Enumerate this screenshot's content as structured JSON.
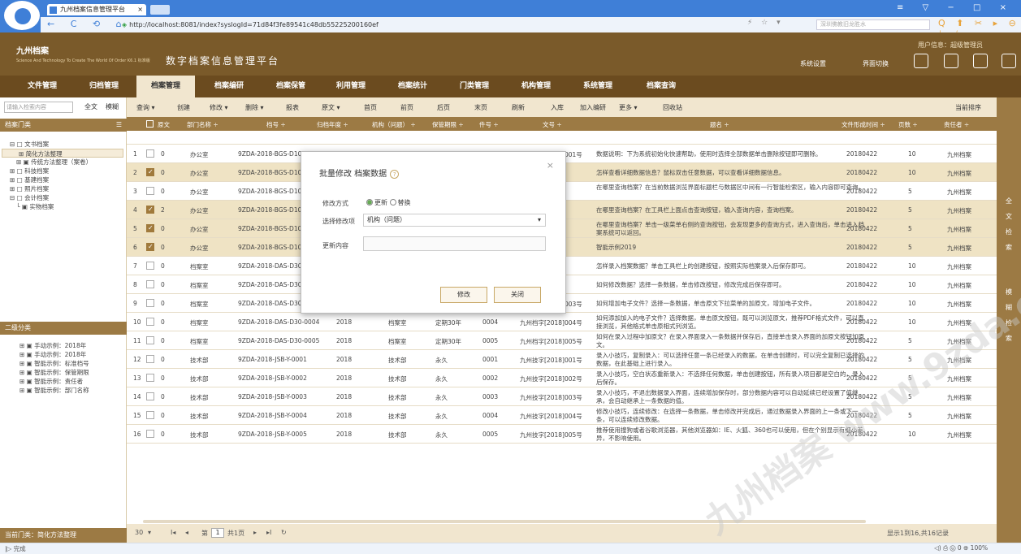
{
  "browser": {
    "tab_title": "九州档案信息管理平台",
    "tab_close": "×",
    "url": "http://localhost:8081/index?syslogId=71d84f3fe89541c48db55225200160ef",
    "search_placeholder": "深圳佛教旧龙胜水",
    "nav_icons": "← C ⟲ ⌂",
    "right_icons": "⚡ ☆ ▾",
    "right_icons2": "Q ⬆ ✂ ▸ ⊖ ⤓ ☆",
    "window_controls": "≡ ▽ − □ ×"
  },
  "header": {
    "logo_main": "九州档案",
    "logo_sub": "Science And Technology To Create The World Of Order  K6.1 标准版",
    "app_title": "数字档案信息管理平台",
    "user_info": "用户信息：超级管理员",
    "system_settings": "系统设置",
    "switch_ui": "界面切换"
  },
  "nav": [
    "文件管理",
    "归档管理",
    "档案管理",
    "档案编研",
    "档案保管",
    "利用管理",
    "档案统计",
    "门类管理",
    "机构管理",
    "系统管理",
    "档案查询"
  ],
  "sidebar": {
    "search_placeholder": "请输入检索内容",
    "fulltext": "全文",
    "fuzzy": "模糊",
    "section1": "档案门类",
    "menu_icon": "☰",
    "tree1": [
      "⊟ □ 文书档案",
      "⊞ 简化方法整理",
      "⊞ ▣ 传统方法整理（案卷）",
      "⊞ □ 科技档案",
      "⊞ □ 基建档案",
      "⊞ □ 照片档案",
      "⊟ □ 会计档案",
      "└ ▣ 实物档案"
    ],
    "section2": "二级分类",
    "tree2": [
      "⊞ ▣ 手动示例：2018年",
      "⊞ ▣ 手动示例：2018年",
      "⊞ ▣ 智能示例：标准档号",
      "⊞ ▣ 智能示例：保管期限",
      "⊞ ▣ 智能示例：责任者",
      "⊞ ▣ 智能示例：部门名称"
    ],
    "current": "当前门类：简化方法整理"
  },
  "toolbar": [
    "查询 ▾",
    "创建",
    "修改 ▾",
    "删除 ▾",
    "报表",
    "原文 ▾",
    "首页",
    "前页",
    "后页",
    "末页",
    "刷新",
    "入库",
    "加入编研",
    "更多 ▾",
    "回收站"
  ],
  "toolbar_right": "当前排序",
  "columns": [
    "原文",
    "部门名称 ÷",
    "档号 ÷",
    "归档年度 ÷",
    "机构（问题） ÷",
    "保管期限 ÷",
    "件号 ÷",
    "文号 ÷",
    "题名 ÷",
    "文件形成时间 ÷",
    "页数 ÷",
    "责任者 ÷"
  ],
  "rows": [
    {
      "n": "1",
      "chk": false,
      "yw": "0",
      "dept": "办公室",
      "dh": "9ZDA-2018-BGS-D10-0001",
      "year": "2018",
      "org": "办公室",
      "term": "定期10年",
      "jh": "0001",
      "wh": "九州查字[2018]001号",
      "title": "数据说明：下为系统初始化快速帮助，使用时选择全部数据单击删除按钮即可删除。",
      "date": "20180422",
      "pages": "10",
      "resp": "九州档案"
    },
    {
      "n": "2",
      "chk": true,
      "yw": "0",
      "dept": "办公室",
      "dh": "9ZDA-2018-BGS-D10",
      "year": "",
      "org": "",
      "term": "",
      "jh": "",
      "wh": "002号",
      "title": "怎样查看详细数据信息？鼠标双击任意数据，可以查看详细数据信息。",
      "date": "20180422",
      "pages": "10",
      "resp": "九州档案"
    },
    {
      "n": "3",
      "chk": false,
      "yw": "0",
      "dept": "办公室",
      "dh": "9ZDA-2018-BGS-D10",
      "year": "",
      "org": "",
      "term": "",
      "jh": "",
      "wh": "003号",
      "title": "在哪里查询档案？在当前数据浏览界面标题栏与数据区中间有一行智能检索区，输入内容即可查询。",
      "date": "20180422",
      "pages": "5",
      "resp": "九州档案"
    },
    {
      "n": "4",
      "chk": true,
      "yw": "2",
      "dept": "办公室",
      "dh": "9ZDA-2018-BGS-D10",
      "year": "",
      "org": "",
      "term": "",
      "jh": "",
      "wh": "004号",
      "title": "在哪里查询档案？在工具栏上面点击查询按钮，输入查询内容，查询档案。",
      "date": "20180422",
      "pages": "5",
      "resp": "九州档案"
    },
    {
      "n": "5",
      "chk": true,
      "yw": "0",
      "dept": "办公室",
      "dh": "9ZDA-2018-BGS-D10",
      "year": "",
      "org": "",
      "term": "",
      "jh": "",
      "wh": "005号",
      "title": "在哪里查询档案？单击一级菜单右侧的查询按钮，会发现更多的查询方式，进入查询后，单击进入档案系统可以返回。",
      "date": "20180422",
      "pages": "5",
      "resp": "九州档案"
    },
    {
      "n": "6",
      "chk": true,
      "yw": "0",
      "dept": "办公室",
      "dh": "9ZDA-2018-BGS-D10",
      "year": "",
      "org": "",
      "term": "",
      "jh": "",
      "wh": "005号",
      "title": "智能示例2019",
      "date": "20180422",
      "pages": "5",
      "resp": "九州档案"
    },
    {
      "n": "7",
      "chk": false,
      "yw": "0",
      "dept": "档案室",
      "dh": "9ZDA-2018-DAS-D30",
      "year": "",
      "org": "",
      "term": "",
      "jh": "",
      "wh": "001号",
      "title": "怎样录入档案数据？单击工具栏上的创建按钮，按照实际档案录入后保存即可。",
      "date": "20180422",
      "pages": "10",
      "resp": "九州档案"
    },
    {
      "n": "8",
      "chk": false,
      "yw": "0",
      "dept": "档案室",
      "dh": "9ZDA-2018-DAS-D30",
      "year": "",
      "org": "",
      "term": "",
      "jh": "",
      "wh": "002号",
      "title": "如何修改数据？选择一条数据，单击修改按钮，修改完成后保存即可。",
      "date": "20180422",
      "pages": "10",
      "resp": "九州档案"
    },
    {
      "n": "9",
      "chk": false,
      "yw": "0",
      "dept": "档案室",
      "dh": "9ZDA-2018-DAS-D30-0003",
      "year": "2018",
      "org": "档案室",
      "term": "定期30年",
      "jh": "0003",
      "wh": "九州档字[2018]003号",
      "title": "如何增加电子文件？选择一条数据，单击原文下拉菜单的加原文，增加电子文件。",
      "date": "20180422",
      "pages": "10",
      "resp": "九州档案"
    },
    {
      "n": "10",
      "chk": false,
      "yw": "0",
      "dept": "档案室",
      "dh": "9ZDA-2018-DAS-D30-0004",
      "year": "2018",
      "org": "档案室",
      "term": "定期30年",
      "jh": "0004",
      "wh": "九州档字[2018]004号",
      "title": "如何添加加入的电子文件？选择数据，单击原文按钮，既可以浏览原文，推荐PDF格式文件，可以直接浏览，其他格式单击原相式列浏览。",
      "date": "20180422",
      "pages": "10",
      "resp": "九州档案"
    },
    {
      "n": "11",
      "chk": false,
      "yw": "0",
      "dept": "档案室",
      "dh": "9ZDA-2018-DAS-D30-0005",
      "year": "2018",
      "org": "档案室",
      "term": "定期30年",
      "jh": "0005",
      "wh": "九州档字[2018]005号",
      "title": "如何在录入过程中加原文？在录入界面录入一条数据并保存后，直接单击录入界面的加原文按钮加原文。",
      "date": "20180422",
      "pages": "5",
      "resp": "九州档案"
    },
    {
      "n": "12",
      "chk": false,
      "yw": "0",
      "dept": "技术部",
      "dh": "9ZDA-2018-JSB-Y-0001",
      "year": "2018",
      "org": "技术部",
      "term": "永久",
      "jh": "0001",
      "wh": "九州技字[2018]001号",
      "title": "录入小技巧，复制录入：可以选择任意一条已经录入的数据，在单击创建时，可以完全复制已选择的数据，在此基础上进行录入。",
      "date": "20180422",
      "pages": "5",
      "resp": "九州档案"
    },
    {
      "n": "13",
      "chk": false,
      "yw": "0",
      "dept": "技术部",
      "dh": "9ZDA-2018-JSB-Y-0002",
      "year": "2018",
      "org": "技术部",
      "term": "永久",
      "jh": "0002",
      "wh": "九州技字[2018]002号",
      "title": "录入小技巧，空白状态重新录入：不选择任何数据，单击创建按钮，所有录入项目都是空白的，录入后保存。",
      "date": "20180422",
      "pages": "5",
      "resp": "九州档案"
    },
    {
      "n": "14",
      "chk": false,
      "yw": "0",
      "dept": "技术部",
      "dh": "9ZDA-2018-JSB-Y-0003",
      "year": "2018",
      "org": "技术部",
      "term": "永久",
      "jh": "0003",
      "wh": "九州技字[2018]003号",
      "title": "录入小技巧，不退出数据录入界面，连续增加保存时，部分数据内容可以自动延续已经设置了值继承，会自动继承上一条数据的值。",
      "date": "20180422",
      "pages": "5",
      "resp": "九州档案"
    },
    {
      "n": "15",
      "chk": false,
      "yw": "0",
      "dept": "技术部",
      "dh": "9ZDA-2018-JSB-Y-0004",
      "year": "2018",
      "org": "技术部",
      "term": "永久",
      "jh": "0004",
      "wh": "九州技字[2018]004号",
      "title": "修改小技巧，连续修改：在选择一条数据，单击修改并完成后，通过数据录入界面的上一条或下一条，可以连续修改数据。",
      "date": "20180422",
      "pages": "5",
      "resp": "九州档案"
    },
    {
      "n": "16",
      "chk": false,
      "yw": "0",
      "dept": "技术部",
      "dh": "9ZDA-2018-JSB-Y-0005",
      "year": "2018",
      "org": "技术部",
      "term": "永久",
      "jh": "0005",
      "wh": "九州技字[2018]005号",
      "title": "推荐使用搜狗或者谷歌浏览器，其他浏览器如：IE、火狐、360也可以使用，但在个别显示有细小差异，不影响使用。",
      "date": "20180422",
      "pages": "10",
      "resp": "九州档案"
    }
  ],
  "rightbar": {
    "g1": [
      "全",
      "文",
      "检",
      "索"
    ],
    "g2": [
      "模",
      "糊",
      "检",
      "索"
    ]
  },
  "pager": {
    "size": "30",
    "size_arrow": "▾",
    "first": "I◂",
    "prev": "◂",
    "page_label": "第",
    "page": "1",
    "total": "共1页",
    "next": "▸",
    "last": "▸I",
    "refresh": "↻",
    "info": "显示1到16,共16记录"
  },
  "dialog": {
    "title": "批量修改  档案数据",
    "help": "?",
    "close": "×",
    "mode_label": "修改方式",
    "opt_update": "更新",
    "opt_replace": "替换",
    "field_label": "选择修改项",
    "field_value": "机构（问题）",
    "content_label": "更新内容",
    "ok": "修改",
    "cancel": "关闭"
  },
  "status": {
    "left": "|▷  完成",
    "right": "◁)   ⎙   ⓦ 0   ⊕ 100%"
  },
  "watermark": "九州档案 www.9zda.com"
}
